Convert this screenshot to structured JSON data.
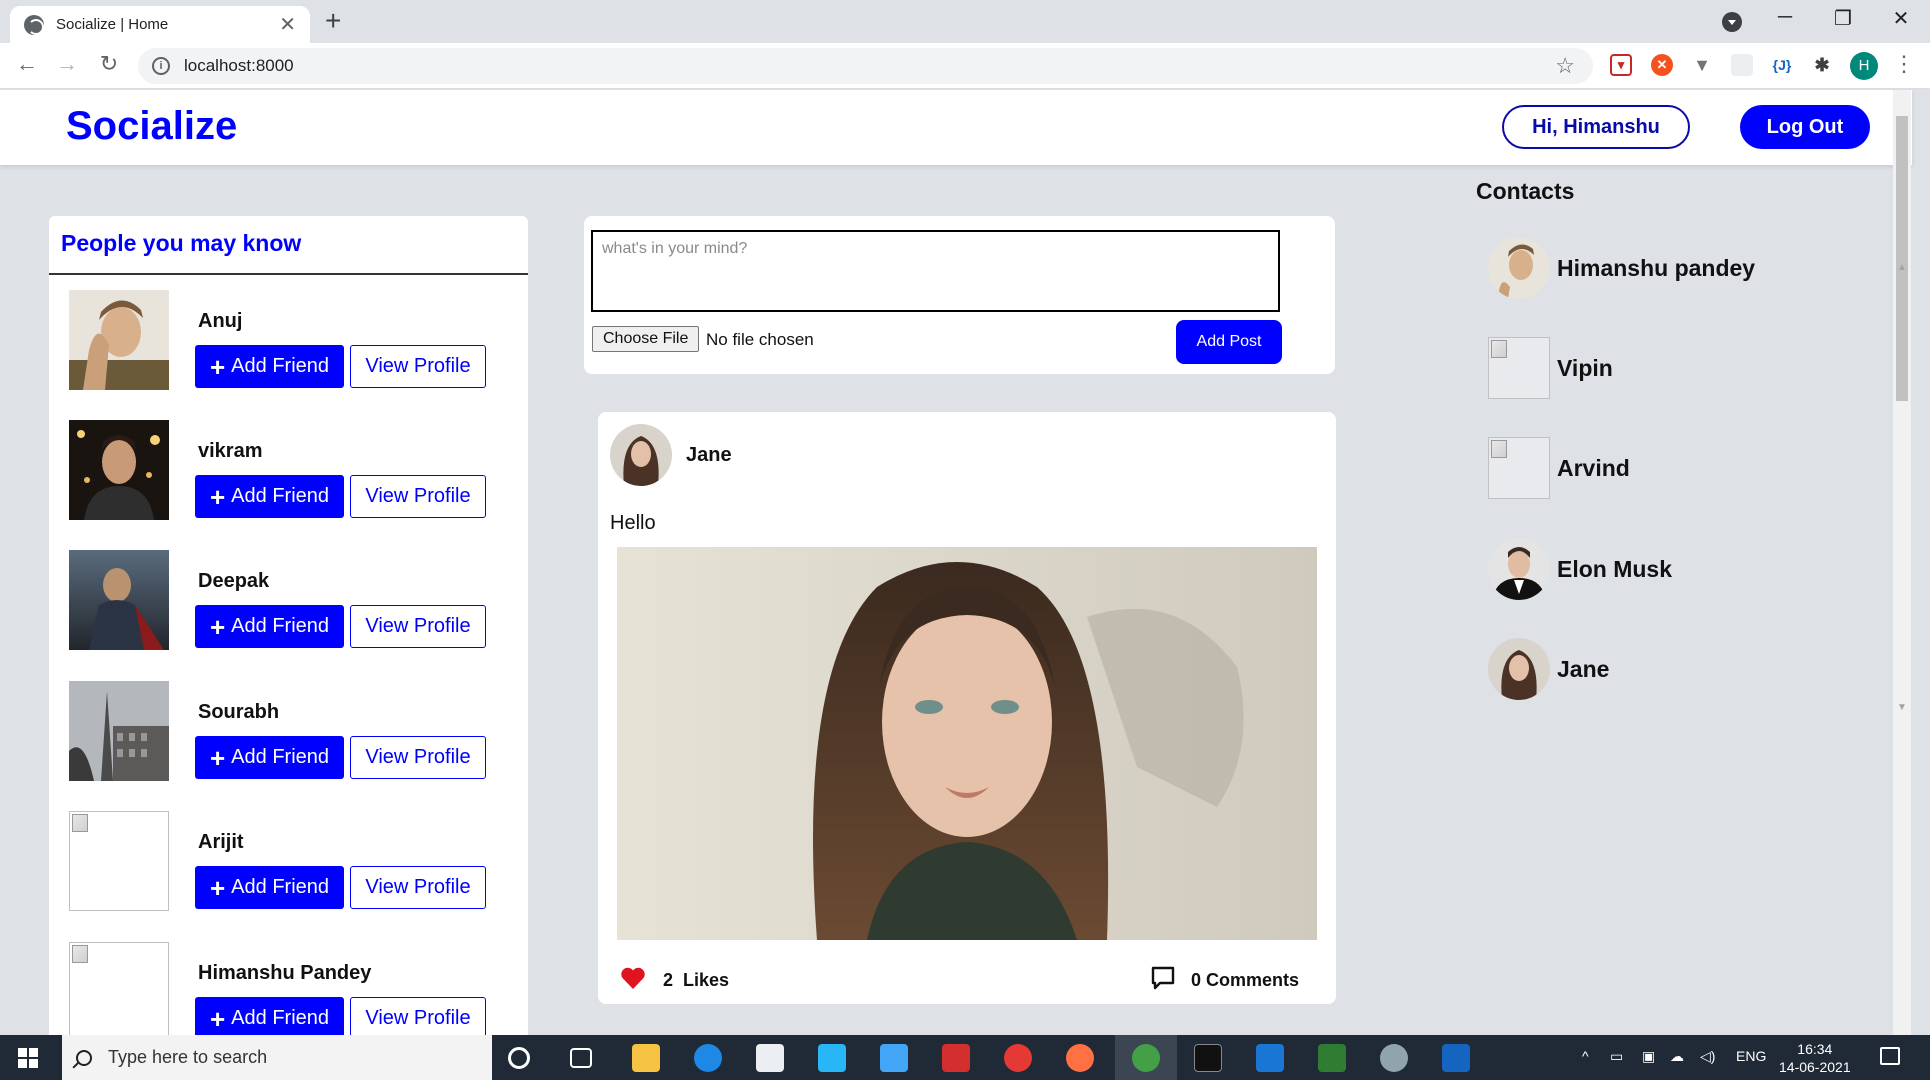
{
  "browser": {
    "tab_title": "Socialize | Home",
    "tab_close": "✕",
    "new_tab": "+",
    "url": "localhost:8000",
    "profile_initial": "H",
    "ext_json_label": "{J}",
    "window_controls": {
      "minimize": "─",
      "maximize": "❐",
      "close": "✕"
    }
  },
  "header": {
    "brand": "Socialize",
    "greeting_button": "Hi, Himanshu",
    "logout_button": "Log Out"
  },
  "people_you_may_know": {
    "title": "People you may know",
    "add_friend_label": "Add Friend",
    "view_profile_label": "View Profile",
    "people": [
      {
        "name": "Anuj",
        "has_photo": true
      },
      {
        "name": "vikram",
        "has_photo": true
      },
      {
        "name": "Deepak",
        "has_photo": true
      },
      {
        "name": "Sourabh",
        "has_photo": true
      },
      {
        "name": "Arijit",
        "has_photo": false
      },
      {
        "name": "Himanshu Pandey",
        "has_photo": false
      }
    ]
  },
  "composer": {
    "placeholder": "what's in your mind?",
    "choose_file": "Choose File",
    "no_file": "No file chosen",
    "add_post": "Add Post"
  },
  "post": {
    "author": "Jane",
    "text": "Hello",
    "likes_count": "2",
    "likes_label": "Likes",
    "comments_count": "0",
    "comments_label": "Comments",
    "like_icon": "heart-icon",
    "comment_icon": "comment-icon"
  },
  "contacts": {
    "title": "Contacts",
    "items": [
      {
        "name": "Himanshu pandey",
        "has_photo": true
      },
      {
        "name": "Vipin",
        "has_photo": false
      },
      {
        "name": "Arvind",
        "has_photo": false
      },
      {
        "name": "Elon Musk",
        "has_photo": true
      },
      {
        "name": "Jane",
        "has_photo": true
      }
    ]
  },
  "taskbar": {
    "search_placeholder": "Type here to search",
    "lang": "ENG",
    "time": "16:34",
    "date": "14-06-2021"
  },
  "colors": {
    "brand_blue": "#0000ff",
    "page_bg": "#dee1e6",
    "like_red": "#e0141e"
  }
}
